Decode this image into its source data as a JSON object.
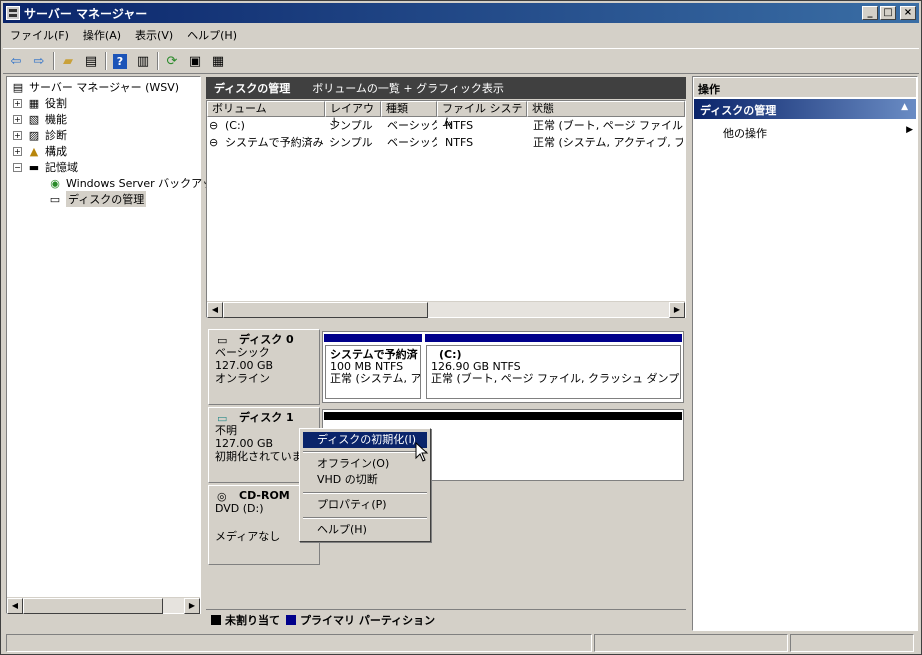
{
  "window": {
    "title": "サーバー マネージャー",
    "minimize": "_",
    "maximize": "□",
    "close": "×"
  },
  "menu": [
    "ファイル(F)",
    "操作(A)",
    "表示(V)",
    "ヘルプ(H)"
  ],
  "toolbar_icons": [
    "back-arrow-icon",
    "forward-arrow-icon",
    "up-folder-icon",
    "show-hide-tree-icon",
    "help-icon",
    "show-hide-action-icon",
    "refresh-icon",
    "properties-icon",
    "wizard-icon"
  ],
  "tree": {
    "root": "サーバー マネージャー (WSV)",
    "items": [
      {
        "label": "役割",
        "expander": "+"
      },
      {
        "label": "機能",
        "expander": "+"
      },
      {
        "label": "診断",
        "expander": "+"
      },
      {
        "label": "構成",
        "expander": "+"
      },
      {
        "label": "記憶域",
        "expander": "−"
      }
    ],
    "storage_children": [
      "Windows Server バックアップ",
      "ディスクの管理"
    ]
  },
  "center": {
    "title": "ディスクの管理",
    "subtitle": "ボリュームの一覧 + グラフィック表示",
    "columns": [
      "ボリューム",
      "レイアウト",
      "種類",
      "ファイル システム",
      "状態"
    ],
    "rows": [
      [
        "(C:)",
        "シンプル",
        "ベーシック",
        "NTFS",
        "正常 (ブート, ページ ファイル, クラ"
      ],
      [
        "システムで予約済み",
        "シンプル",
        "ベーシック",
        "NTFS",
        "正常 (システム, アクティブ, プライ"
      ]
    ]
  },
  "disks": [
    {
      "name": "ディスク 0",
      "type": "ベーシック",
      "size": "127.00 GB",
      "status": "オンライン",
      "volumes": [
        {
          "name": "システムで予約済",
          "size": "100 MB NTFS",
          "status": "正常 (システム, ア"
        },
        {
          "name": "(C:)",
          "size": "126.90 GB NTFS",
          "status": "正常 (ブート, ページ ファイル, クラッシュ ダンプ, プライ"
        }
      ]
    },
    {
      "name": "ディスク 1",
      "type": "不明",
      "size": "127.00 GB",
      "status": "初期化されていま"
    },
    {
      "name": "CD-ROM",
      "type": "DVD (D:)",
      "size": "",
      "status": "メディアなし"
    }
  ],
  "legend": [
    {
      "label": "未割り当て",
      "color": "#000000"
    },
    {
      "label": "プライマリ パーティション",
      "color": "#00008b"
    }
  ],
  "context_menu": [
    "ディスクの初期化(I)",
    "オフライン(O)",
    "VHD の切断",
    "プロパティ(P)",
    "ヘルプ(H)"
  ],
  "actions": {
    "header": "操作",
    "section": "ディスクの管理",
    "item": "他の操作"
  }
}
